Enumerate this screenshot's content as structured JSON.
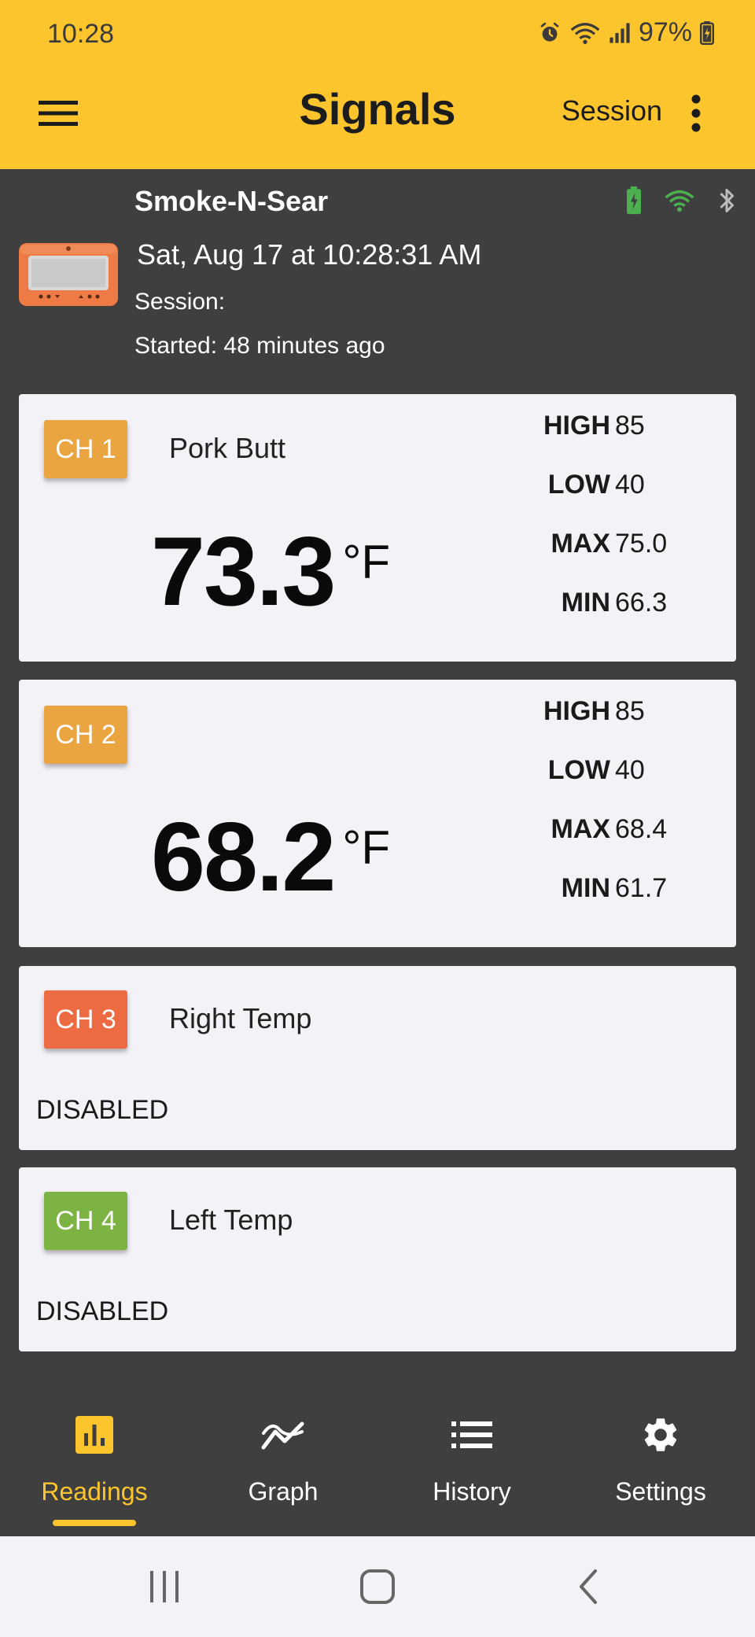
{
  "status_bar": {
    "time": "10:28",
    "battery": "97%",
    "icons": [
      "alarm-icon",
      "wifi-icon",
      "signal-icon",
      "battery-icon"
    ]
  },
  "app_bar": {
    "title": "Signals",
    "session_label": "Session",
    "menu_icon": "menu-icon",
    "more_icon": "more-vert-icon"
  },
  "device": {
    "name": "Smoke-N-Sear",
    "date_time": "Sat, Aug 17  at 10:28:31 AM",
    "session": "Session:",
    "started": "Started: 48 minutes ago",
    "icons": [
      "battery-charging-icon",
      "wifi-icon",
      "bluetooth-icon"
    ]
  },
  "channels": [
    {
      "badge": "CH 1",
      "name": "Pork Butt",
      "color": "#eaa541",
      "temp": "73.3",
      "unit": "°F",
      "stats": [
        {
          "label": "HIGH",
          "value": "85"
        },
        {
          "label": "LOW",
          "value": "40"
        },
        {
          "label": "MAX",
          "value": "75.0"
        },
        {
          "label": "MIN",
          "value": "66.3"
        }
      ]
    },
    {
      "badge": "CH 2",
      "name": "",
      "color": "#eaa541",
      "temp": "68.2",
      "unit": "°F",
      "stats": [
        {
          "label": "HIGH",
          "value": "85"
        },
        {
          "label": "LOW",
          "value": "40"
        },
        {
          "label": "MAX",
          "value": "68.4"
        },
        {
          "label": "MIN",
          "value": "61.7"
        }
      ]
    },
    {
      "badge": "CH 3",
      "name": "Right Temp",
      "color": "#ec6b43",
      "status": "DISABLED"
    },
    {
      "badge": "CH 4",
      "name": "Left Temp",
      "color": "#7cb342",
      "status": "DISABLED"
    }
  ],
  "bottom_nav": [
    {
      "label": "Readings",
      "icon": "bar-chart-icon",
      "active": true
    },
    {
      "label": "Graph",
      "icon": "trend-icon",
      "active": false
    },
    {
      "label": "History",
      "icon": "list-icon",
      "active": false
    },
    {
      "label": "Settings",
      "icon": "gear-icon",
      "active": false
    }
  ],
  "colors": {
    "accent": "#fdc52d",
    "background": "#3f3f3f",
    "card": "#f3f2f7",
    "connected_green": "#4caf50"
  }
}
